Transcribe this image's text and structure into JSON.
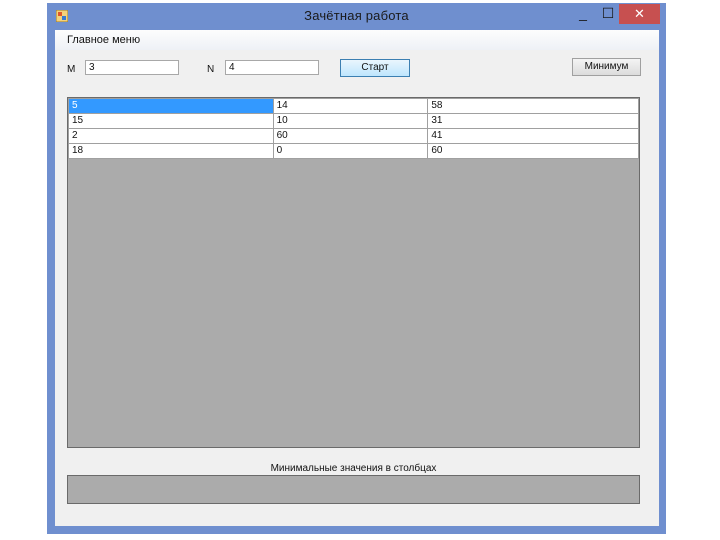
{
  "window": {
    "title": "Зачётная работа",
    "controls": {
      "minimize": "_",
      "maximize": "☐",
      "close": "✕"
    }
  },
  "menu": {
    "main": "Главное меню"
  },
  "inputs": {
    "m_label": "M",
    "m_value": "3",
    "n_label": "N",
    "n_value": "4"
  },
  "buttons": {
    "start": "Старт",
    "minimum": "Минимум"
  },
  "grid": {
    "rows": [
      [
        "5",
        "14",
        "58"
      ],
      [
        "15",
        "10",
        "31"
      ],
      [
        "2",
        "60",
        "41"
      ],
      [
        "18",
        "0",
        "60"
      ]
    ],
    "selected_cell": "5"
  },
  "result": {
    "caption": "Минимальные значения в столбцах"
  },
  "colors": {
    "titlebar": "#6f8fcf",
    "close": "#c75050",
    "selection": "#3399ff",
    "grid_background": "#ababab"
  }
}
